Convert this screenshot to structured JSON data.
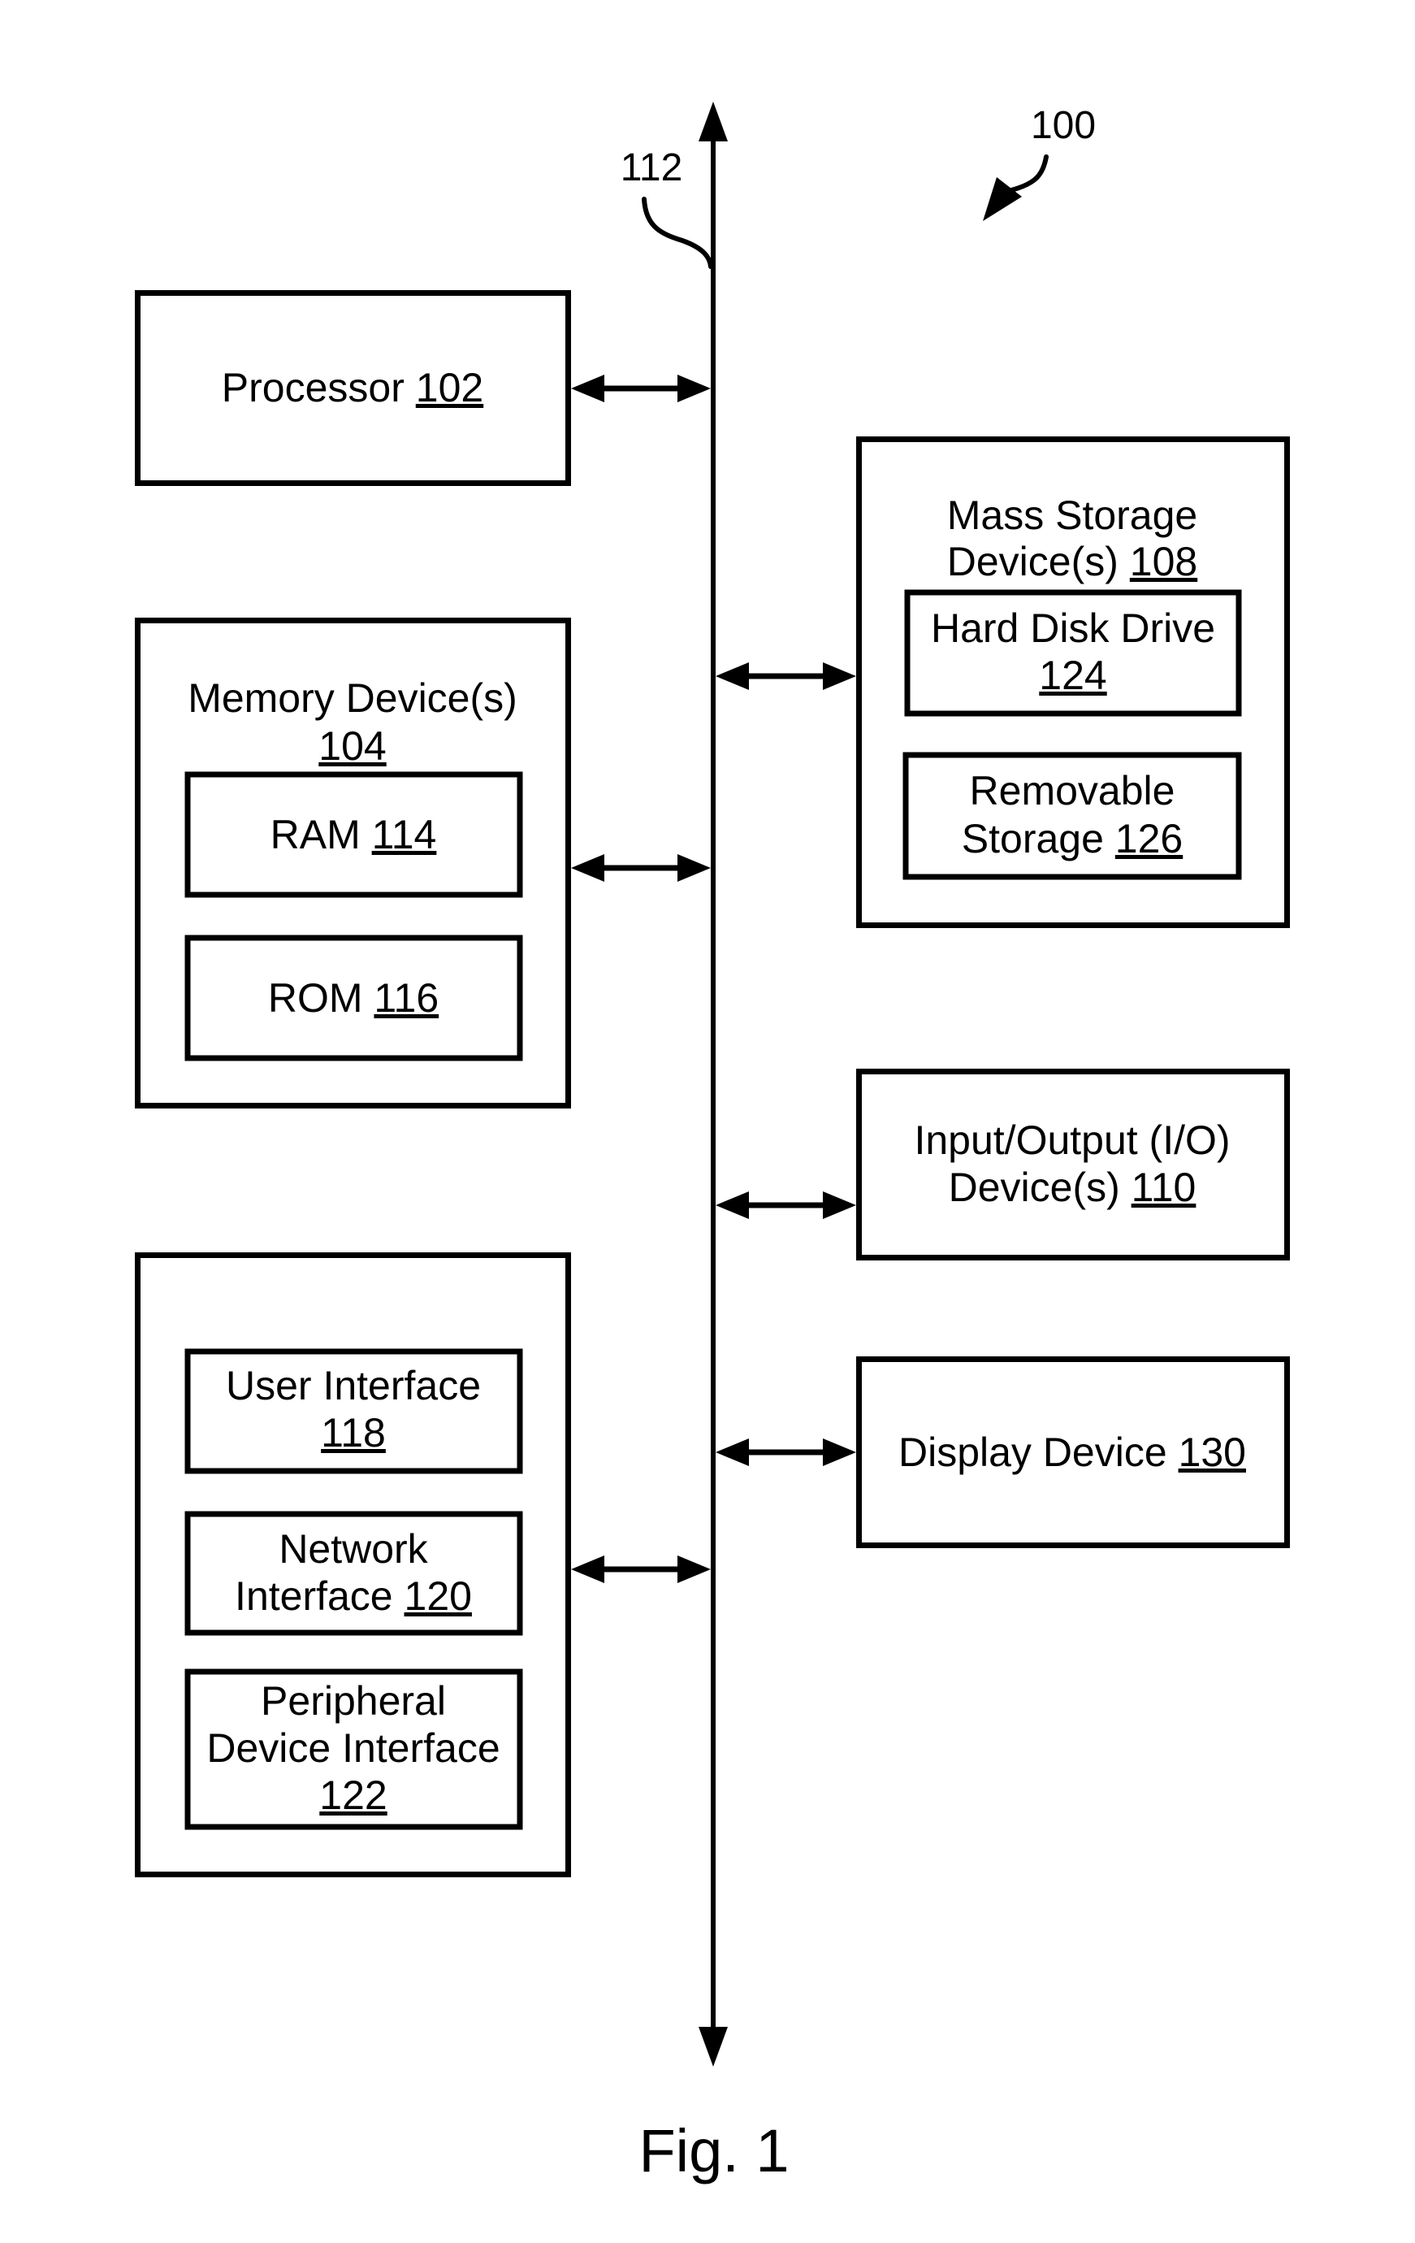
{
  "figure": {
    "caption": "Fig. 1",
    "system_ref": "100",
    "bus_ref": "112"
  },
  "blocks": {
    "processor": {
      "name": "Processor",
      "ref": "102"
    },
    "memory": {
      "name": "Memory Device(s)",
      "ref": "104",
      "children": {
        "ram": {
          "name": "RAM",
          "ref": "114"
        },
        "rom": {
          "name": "ROM",
          "ref": "116"
        }
      }
    },
    "interfaces": {
      "children": {
        "user_interface": {
          "line1": "User Interface",
          "ref": "118"
        },
        "network_interface": {
          "line1": "Network",
          "line2": "Interface",
          "ref": "120"
        },
        "peripheral_interface": {
          "line1": "Peripheral",
          "line2": "Device Interface",
          "ref": "122"
        }
      }
    },
    "mass_storage": {
      "line1": "Mass Storage",
      "line2": "Device(s)",
      "ref": "108",
      "children": {
        "hdd": {
          "line1": "Hard Disk Drive",
          "ref": "124"
        },
        "removable": {
          "line1": "Removable",
          "line2": "Storage",
          "ref": "126"
        }
      }
    },
    "io": {
      "line1": "Input/Output (I/O)",
      "line2": "Device(s)",
      "ref": "110"
    },
    "display": {
      "name": "Display Device",
      "ref": "130"
    }
  },
  "connections": [
    {
      "from": "processor",
      "to": "bus",
      "type": "bidirectional"
    },
    {
      "from": "memory",
      "to": "bus",
      "type": "bidirectional"
    },
    {
      "from": "interfaces",
      "to": "bus",
      "type": "bidirectional"
    },
    {
      "from": "mass_storage",
      "to": "bus",
      "type": "bidirectional"
    },
    {
      "from": "io",
      "to": "bus",
      "type": "bidirectional"
    },
    {
      "from": "display",
      "to": "bus",
      "type": "bidirectional"
    }
  ]
}
